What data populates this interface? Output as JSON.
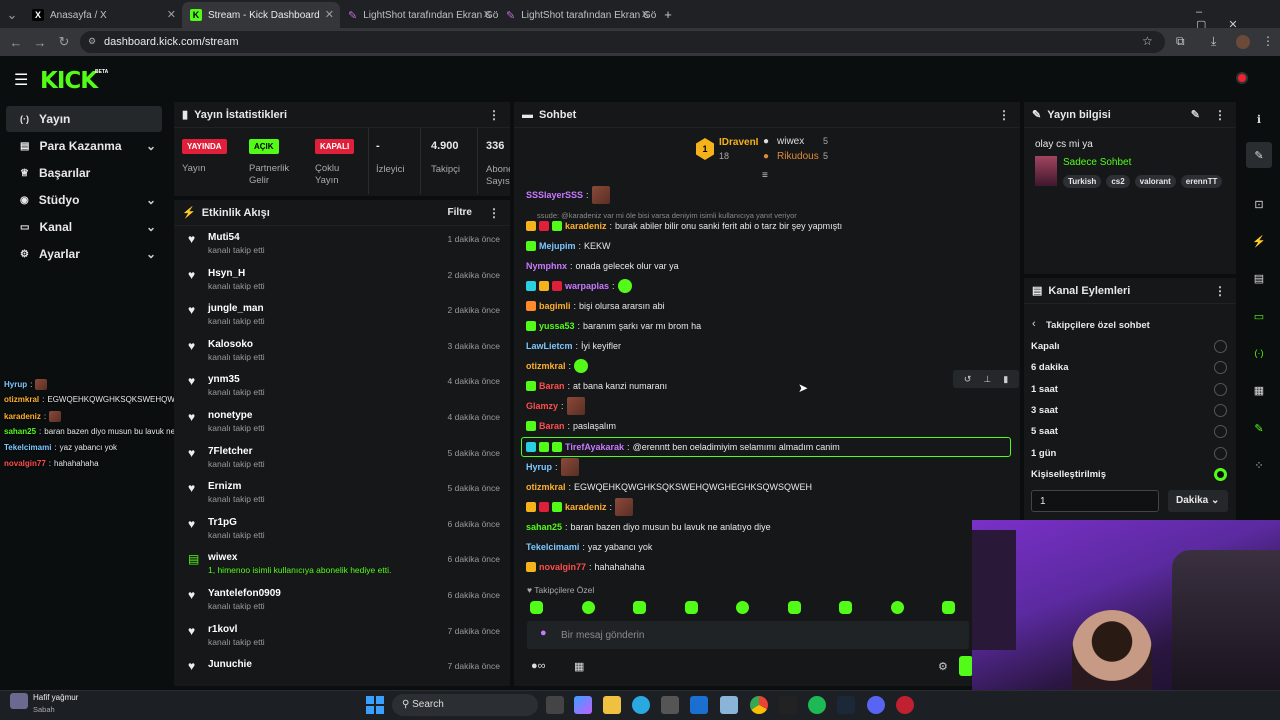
{
  "browser": {
    "tabs": [
      {
        "title": "Anasayfa / X",
        "icon": "x-logo-icon"
      },
      {
        "title": "Stream - Kick Dashboard",
        "icon": "kick-logo-icon",
        "active": true
      },
      {
        "title": "LightShot tarafından Ekran Görü",
        "icon": "lightshot-icon"
      },
      {
        "title": "LightShot tarafından Ekran Görü",
        "icon": "lightshot-icon"
      }
    ],
    "url": "dashboard.kick.com/stream"
  },
  "brand": {
    "logo": "KICK",
    "beta": "BETA"
  },
  "sidebar": {
    "items": [
      {
        "label": "Yayın",
        "icon": "stream-icon"
      },
      {
        "label": "Para Kazanma",
        "icon": "money-icon"
      },
      {
        "label": "Başarılar",
        "icon": "trophy-icon"
      },
      {
        "label": "Stüdyo",
        "icon": "studio-icon"
      },
      {
        "label": "Kanal",
        "icon": "channel-icon"
      },
      {
        "label": "Ayarlar",
        "icon": "gear-icon"
      }
    ]
  },
  "stats": {
    "title": "Yayın İstatistikleri",
    "live_badge": "YAYINDA",
    "live_label": "Yayın",
    "open_badge": "AÇIK",
    "open_label": "Partnerlik Gelir Programı",
    "closed_badge": "KAPALI",
    "closed_label": "Çoklu Yayın",
    "viewers_value": "-",
    "viewers_label": "İzleyici",
    "followers_value": "4.900",
    "followers_label": "Takipçi",
    "subs_value": "336",
    "subs_label": "Abone Sayısı"
  },
  "activity": {
    "title": "Etkinlik Akışı",
    "filter": "Filtre",
    "events": [
      {
        "name": "Muti54",
        "desc": "kanalı takip etti",
        "time": "1 dakika önce"
      },
      {
        "name": "Hsyn_H",
        "desc": "kanalı takip etti",
        "time": "2 dakika önce"
      },
      {
        "name": "jungle_man",
        "desc": "kanalı takip etti",
        "time": "2 dakika önce"
      },
      {
        "name": "Kalosoko",
        "desc": "kanalı takip etti",
        "time": "3 dakika önce"
      },
      {
        "name": "ynm35",
        "desc": "kanalı takip etti",
        "time": "4 dakika önce"
      },
      {
        "name": "nonetype",
        "desc": "kanalı takip etti",
        "time": "4 dakika önce"
      },
      {
        "name": "7Fletcher",
        "desc": "kanalı takip etti",
        "time": "5 dakika önce"
      },
      {
        "name": "Ernizm",
        "desc": "kanalı takip etti",
        "time": "5 dakika önce"
      },
      {
        "name": "Tr1pG",
        "desc": "kanalı takip etti",
        "time": "6 dakika önce"
      },
      {
        "name": "wiwex",
        "desc": "1, himenoo isimli kullanıcıya abonelik hediye etti.",
        "time": "6 dakika önce"
      },
      {
        "name": "Yantelefon0909",
        "desc": "kanalı takip etti",
        "time": "6 dakika önce"
      },
      {
        "name": "r1kovl",
        "desc": "kanalı takip etti",
        "time": "7 dakika önce"
      },
      {
        "name": "Junuchie",
        "desc": "",
        "time": "7 dakika önce"
      }
    ]
  },
  "chat": {
    "title": "Sohbet",
    "top1": "IDravenI",
    "top1_count": "18",
    "top2": "wiwex",
    "top2_count": "5",
    "top3": "Rikudous",
    "top3_count": "5",
    "reply_hint": "ssude: @karadeniz var mi öle bisi varsa deniyim isimli kullanıcıya yanıt veriyor",
    "messages": [
      {
        "user": "SSSlayerSSS",
        "color": "#c87aff",
        "text": ""
      },
      {
        "user": "karadeniz",
        "color": "#ffb02e",
        "text": "burak abiler bilir onu sanki ferit abi o tarz bir şey yapmıştı"
      },
      {
        "user": "Mejupim",
        "color": "#7ec8ff",
        "text": "KEKW"
      },
      {
        "user": "Nymphnx",
        "color": "#c87aff",
        "text": "onada gelecek olur var ya"
      },
      {
        "user": "warpaplas",
        "color": "#c87aff",
        "text": ""
      },
      {
        "user": "bagimli",
        "color": "#ffb02e",
        "text": "bişi olursa ararsın abi"
      },
      {
        "user": "yussa53",
        "color": "#53fc18",
        "text": "baranım şarkı var mı brom ha"
      },
      {
        "user": "LawLietcm",
        "color": "#7ec8ff",
        "text": "İyi keyifler"
      },
      {
        "user": "otizmkral",
        "color": "#ffb02e",
        "text": ""
      },
      {
        "user": "Baran",
        "color": "#ff4d4d",
        "text": "at bana kanzi numaranı"
      },
      {
        "user": "Glamzy",
        "color": "#ff4d4d",
        "text": ""
      },
      {
        "user": "Baran",
        "color": "#ff4d4d",
        "text": "paslaşalım"
      },
      {
        "user": "TirefAyakarak",
        "color": "#c87aff",
        "text": "@erenntt ben oeladimiyim selamımı almadım canim"
      },
      {
        "user": "Hyrup",
        "color": "#7ec8ff",
        "text": ""
      },
      {
        "user": "otizmkral",
        "color": "#ffb02e",
        "text": "EGWQEHKQWGHKSQKSWEHQWGHEGHKSQWSQWEH"
      },
      {
        "user": "karadeniz",
        "color": "#ffb02e",
        "text": ""
      },
      {
        "user": "sahan25",
        "color": "#53fc18",
        "text": "baran bazen diyo musun bu lavuk ne anlatıyo diye"
      },
      {
        "user": "Tekelcimami",
        "color": "#7ec8ff",
        "text": "yaz yabancı yok"
      },
      {
        "user": "novalgin77",
        "color": "#ff4d4d",
        "text": "hahahahaha"
      }
    ],
    "followers_only": "Takipçilere Özel",
    "input_placeholder": "Bir mesaj gönderin"
  },
  "overlay": [
    {
      "user": "Hyrup",
      "color": "#7ec8ff",
      "text": ""
    },
    {
      "user": "otizmkral",
      "color": "#ffb02e",
      "text": "EGWQEHKQWGHKSQKSWEHQWGHEGHKSQWSQWEH"
    },
    {
      "user": "karadeniz",
      "color": "#ffb02e",
      "text": ""
    },
    {
      "user": "sahan25",
      "color": "#53fc18",
      "text": "baran bazen diyo musun bu lavuk ne anlatıyo diye"
    },
    {
      "user": "Tekelcimami",
      "color": "#7ec8ff",
      "text": "yaz yabancı yok"
    },
    {
      "user": "novalgin77",
      "color": "#ff4d4d",
      "text": "hahahahaha"
    }
  ],
  "info": {
    "title": "Yayın bilgisi",
    "stream_title": "olay cs mi ya",
    "category": "Sadece Sohbet",
    "tags": [
      "Turkish",
      "cs2",
      "valorant",
      "erennTT"
    ]
  },
  "actions": {
    "title": "Kanal Eylemleri",
    "back_label": "Takipçilere özel sohbet",
    "options": [
      {
        "label": "Kapalı",
        "selected": false
      },
      {
        "label": "6 dakika",
        "selected": false
      },
      {
        "label": "1 saat",
        "selected": false
      },
      {
        "label": "3 saat",
        "selected": false
      },
      {
        "label": "5 saat",
        "selected": false
      },
      {
        "label": "1 gün",
        "selected": false
      },
      {
        "label": "Kişiselleştirilmiş",
        "selected": true
      }
    ],
    "custom_value": "1",
    "unit": "Dakika"
  },
  "taskbar": {
    "weather": "Hafif yağmur",
    "weather_sub": "Sabah",
    "search": "Search"
  }
}
